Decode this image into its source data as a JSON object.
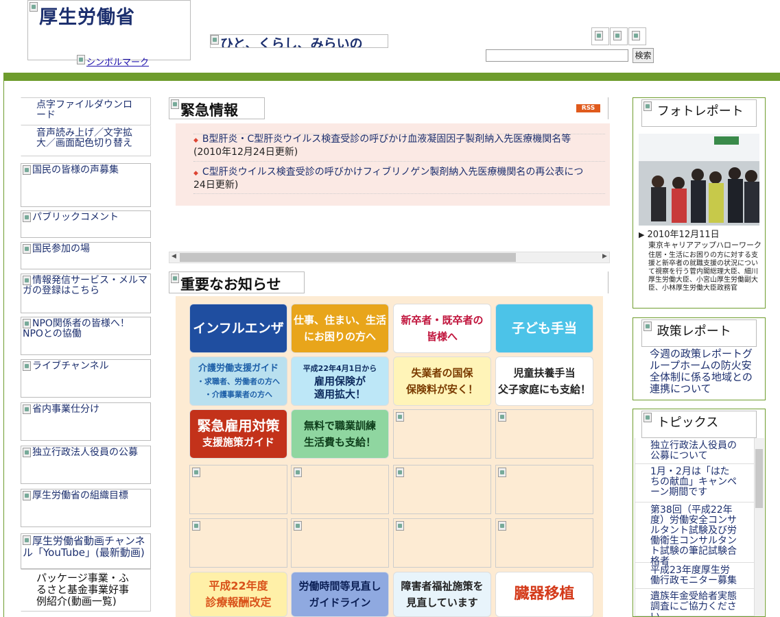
{
  "header": {
    "logo_alt": "厚生労働省",
    "symbol_link": "シンボルマーク",
    "slogan": "ひと、くらし、みらいの",
    "search_input_value": "",
    "search_button": "検索"
  },
  "left_nav": {
    "top_links": [
      "点字ファイルダウンロード",
      "音声読み上げ／文字拡大／画面配色切り替え"
    ],
    "items": [
      "国民の皆様の声募集",
      "パブリックコメント",
      "国民参加の場",
      "情報発信サービス・メルマガの登録はこちら",
      "NPO関係者の皆様へ！NPOとの協働",
      "ライブチャンネル",
      "省内事業仕分け",
      "独立行政法人役員の公募",
      "厚生労働省の組織目標",
      "厚生労働省動画チャンネル「YouTube」(最新動画)"
    ],
    "bottom_link": "パッケージ事業・ふるさと基金事業好事例紹介(動画一覧)"
  },
  "emergency": {
    "title": "緊急情報",
    "rss": "RSS",
    "items": [
      {
        "text": "B型肝炎・C型肝炎ウイルス検査受診の呼びかけ血液凝固因子製剤納入先医療機関名等",
        "date": "(2010年12月24日更新)"
      },
      {
        "text": "C型肝炎ウイルス検査受診の呼びかけフィブリノゲン製剤納入先医療機関名の再公表につ",
        "date": "24日更新)"
      }
    ]
  },
  "notices": {
    "title": "重要なお知らせ",
    "tiles": [
      {
        "lines": [
          "インフルエンザ"
        ],
        "bg": "#1f4ea0",
        "fg": "#ffffff"
      },
      {
        "lines": [
          "仕事、住まい、生活",
          "にお困りの方へ"
        ],
        "bg": "#e8a51b",
        "fg": "#ffffff"
      },
      {
        "lines": [
          "新卒者・既卒者の",
          "皆様へ"
        ],
        "bg": "#ffffff",
        "fg": "#c0143c"
      },
      {
        "lines": [
          "子ども手当"
        ],
        "bg": "#4cc3e8",
        "fg": "#ffffff"
      },
      {
        "lines": [
          "介護労働支援ガイド",
          "・求職者、労働者の方へ",
          "・介護事業者の方へ"
        ],
        "bg": "#b9e0ef",
        "fg": "#1d5fa8"
      },
      {
        "lines": [
          "平成22年4月1日から",
          "雇用保険が",
          "適用拡大！"
        ],
        "bg": "#bde7f7",
        "fg": "#0d2b5e"
      },
      {
        "lines": [
          "失業者の国保",
          "保険料が安く！"
        ],
        "bg": "#fff4b8",
        "fg": "#7a3b00"
      },
      {
        "lines": [
          "児童扶養手当",
          "父子家庭にも支給！"
        ],
        "bg": "#ffffff",
        "fg": "#222222"
      },
      {
        "lines": [
          "緊急雇用対策",
          "支援施策ガイド"
        ],
        "bg": "#c3321a",
        "fg": "#ffffff"
      },
      {
        "lines": [
          "無料で職業訓練",
          "生活費も支給！"
        ],
        "bg": "#8fd6a0",
        "fg": "#0d3d1a"
      },
      {
        "lines": [
          "平成22年度",
          "診療報酬改定"
        ],
        "bg": "#fff0a8",
        "fg": "#d9521a"
      },
      {
        "lines": [
          "労働時間等見直し",
          "ガイドライン"
        ],
        "bg": "#8fa9e0",
        "fg": "#0b1f55"
      },
      {
        "lines": [
          "障害者福祉施策を",
          "見直しています"
        ],
        "bg": "#e8f4fb",
        "fg": "#222222"
      },
      {
        "lines": [
          "臓器移植"
        ],
        "bg": "#ffffff",
        "fg": "#d43a1a"
      }
    ]
  },
  "right": {
    "photo_title": "フォトレポート",
    "photo_date": "2010年12月11日",
    "photo_place": "東京キャリアアップハローワーク",
    "photo_caption": "住居・生活にお困りの方に対する支援と新卒者の就職支援の状況について視察を行う菅内閣総理大臣、細川厚生労働大臣、小宮山厚生労働副大臣、小林厚生労働大臣政務官",
    "policy_title": "政策レポート",
    "policy_link": "今週の政策レポートグループホームの防火安全体制に係る地域との連携について",
    "topics_title": "トピックス",
    "topics": [
      "独立行政法人役員の公募について",
      "1月・2月は「はたちの献血」キャンペーン期間です",
      "第38回（平成22年度）労働安全コンサルタント試験及び労働衛生コンサルタント試験の筆記試験合格者",
      "平成23年度厚生労働行政モニター募集",
      "遺族年金受給者実態調査にご協力ください"
    ]
  },
  "colors": {
    "accent_green": "#6e9c2d",
    "link_navy": "#1c2f6e",
    "emergency_bg": "#fbe9e4",
    "notice_bg": "#fdebd3"
  }
}
